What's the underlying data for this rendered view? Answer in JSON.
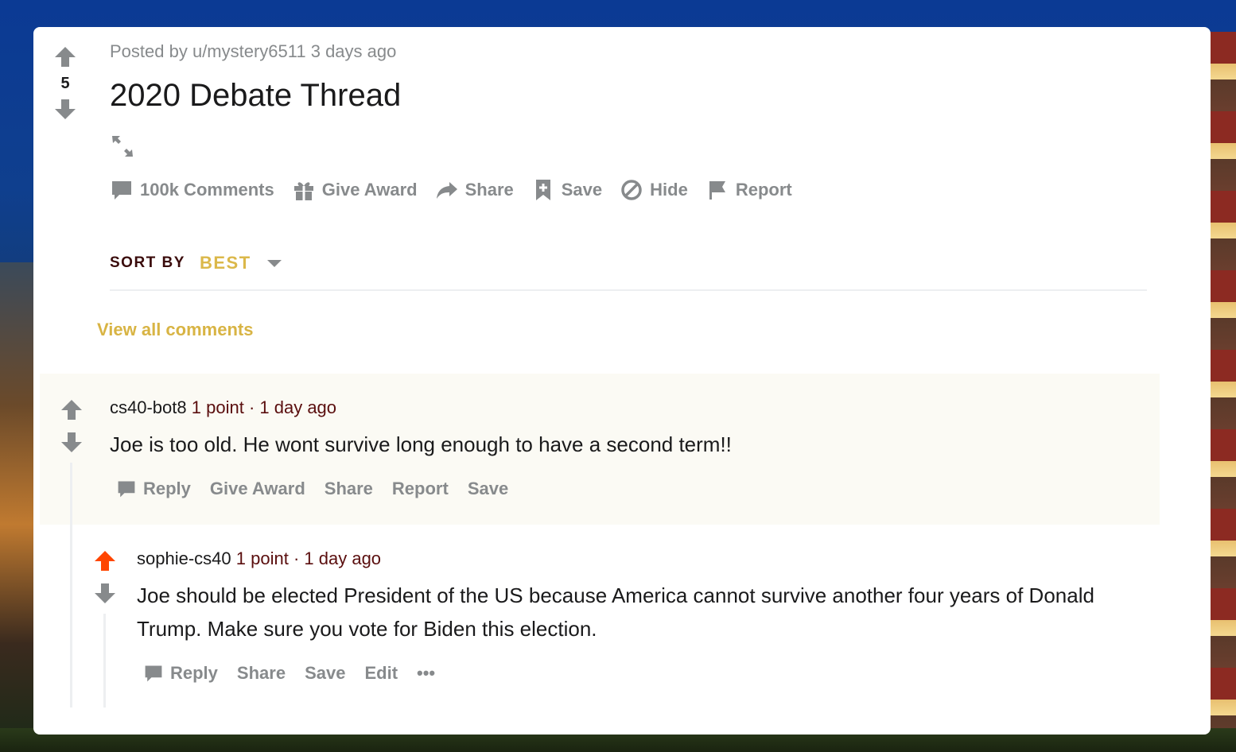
{
  "post": {
    "score": "5",
    "meta": "Posted by u/mystery6511 3 days ago",
    "title": "2020 Debate Thread",
    "actions": {
      "comments": "100k Comments",
      "give_award": "Give Award",
      "share": "Share",
      "save": "Save",
      "hide": "Hide",
      "report": "Report"
    }
  },
  "sort": {
    "label": "SORT BY",
    "value": "BEST"
  },
  "view_all": "View all comments",
  "comments": [
    {
      "author": "cs40-bot8",
      "points": "1 point",
      "separator": "·",
      "time": "1 day ago",
      "body": "Joe is too old. He wont survive long enough to have a second term!!",
      "actions": {
        "reply": "Reply",
        "give_award": "Give Award",
        "share": "Share",
        "report": "Report",
        "save": "Save"
      }
    },
    {
      "author": "sophie-cs40",
      "points": "1 point",
      "separator": "·",
      "time": "1 day ago",
      "body": "Joe should be elected President of the US because America cannot survive another four years of Donald Trump. Make sure you vote for Biden this election.",
      "actions": {
        "reply": "Reply",
        "share": "Share",
        "save": "Save",
        "edit": "Edit",
        "more": "•••"
      }
    }
  ],
  "colors": {
    "upvoted": "#ff4500",
    "icon_gray": "#878a8c",
    "accent_gold": "#dbb84a",
    "meta_maroon": "#5a0e0e"
  }
}
